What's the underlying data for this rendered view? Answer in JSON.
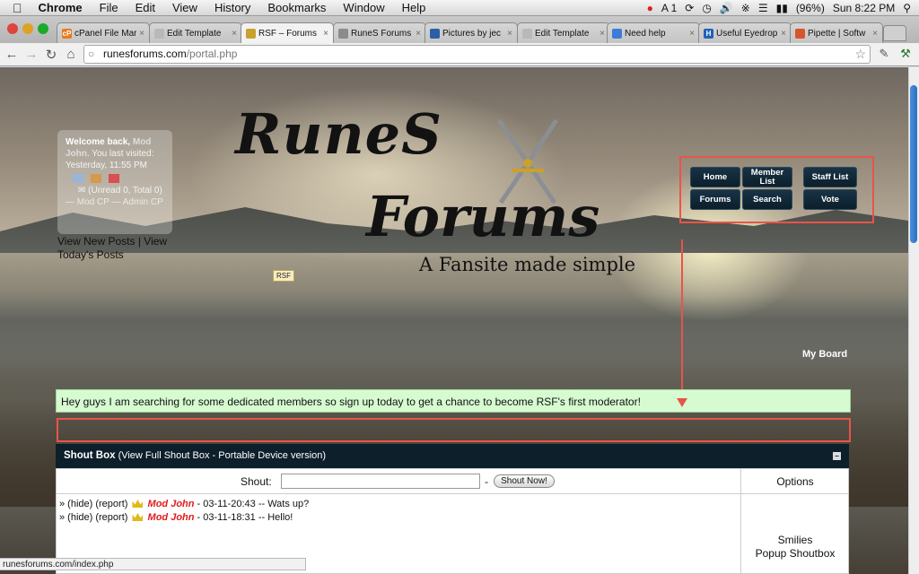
{
  "menubar": {
    "app": "Chrome",
    "items": [
      "File",
      "Edit",
      "View",
      "History",
      "Bookmarks",
      "Window",
      "Help"
    ],
    "status": {
      "adobe": "A 1",
      "battery": "(96%)",
      "clock": "Sun 8:22 PM"
    }
  },
  "tabs": [
    {
      "label": "cPanel File Mar",
      "fav": "cP",
      "color": "#e87a1e"
    },
    {
      "label": "Edit Template",
      "fav": "",
      "color": "#b9b9b9"
    },
    {
      "label": "RSF – Forums",
      "fav": "",
      "color": "#c9a12d"
    },
    {
      "label": "RuneS Forums",
      "fav": "",
      "color": "#8b8b8b"
    },
    {
      "label": "Pictures by jec",
      "fav": "",
      "color": "#2c5fa8"
    },
    {
      "label": "Edit Template",
      "fav": "",
      "color": "#b9b9b9"
    },
    {
      "label": "Need help",
      "fav": "",
      "color": "#3c7bd9"
    },
    {
      "label": "Useful Eyedrop",
      "fav": "H",
      "color": "#1f62b8"
    },
    {
      "label": "Pipette | Softw",
      "fav": "",
      "color": "#d6552a"
    }
  ],
  "active_tab": 2,
  "url": {
    "domain": "runesforums.com",
    "path": "/portal.php"
  },
  "welcome": {
    "greet": "Welcome back,",
    "user": "Mod John",
    "visited": ". You last visited: Yesterday, 11:55 PM",
    "unread": "(Unread 0, Total 0)",
    "modcp": "— Mod CP",
    "admincp": "— Admin CP"
  },
  "viewposts": {
    "new": "View New Posts",
    "sep": " | ",
    "today": "View Today's Posts"
  },
  "logo": {
    "line1": "RuneS",
    "line2": "Forums",
    "tagline": "A Fansite made simple",
    "badge": "RSF"
  },
  "nav": [
    {
      "label": "Home"
    },
    {
      "label": "Member List"
    },
    {
      "label": "Staff List"
    },
    {
      "label": "Forums"
    },
    {
      "label": "Search"
    },
    {
      "label": "Vote"
    }
  ],
  "myboard": "My Board",
  "announcement": "Hey guys I am searching for some dedicated members so sign up today to get a chance to become RSF's first moderator!",
  "shoutbox": {
    "title": "Shout Box",
    "links": "(View Full Shout Box - Portable Device version)",
    "collapse": "−",
    "shout_label": "Shout:",
    "dash": "-",
    "button": "Shout Now!",
    "options": "Options",
    "smilies": "Smilies",
    "popup": "Popup Shoutbox",
    "messages": [
      {
        "prefix": "» (hide) (report)",
        "user": "Mod John",
        "text": " - 03-11-20:43 -- Wats up?"
      },
      {
        "prefix": "» (hide) (report)",
        "user": "Mod John",
        "text": " - 03-11-18:31 -- Hello!"
      }
    ]
  },
  "statusbar": "runesforums.com/index.php",
  "colors": {
    "accent_red": "#e8544a",
    "nav_bg": "#0c1f2b",
    "announce_bg": "#d6fbd0",
    "mod_red": "#e01b1b"
  }
}
